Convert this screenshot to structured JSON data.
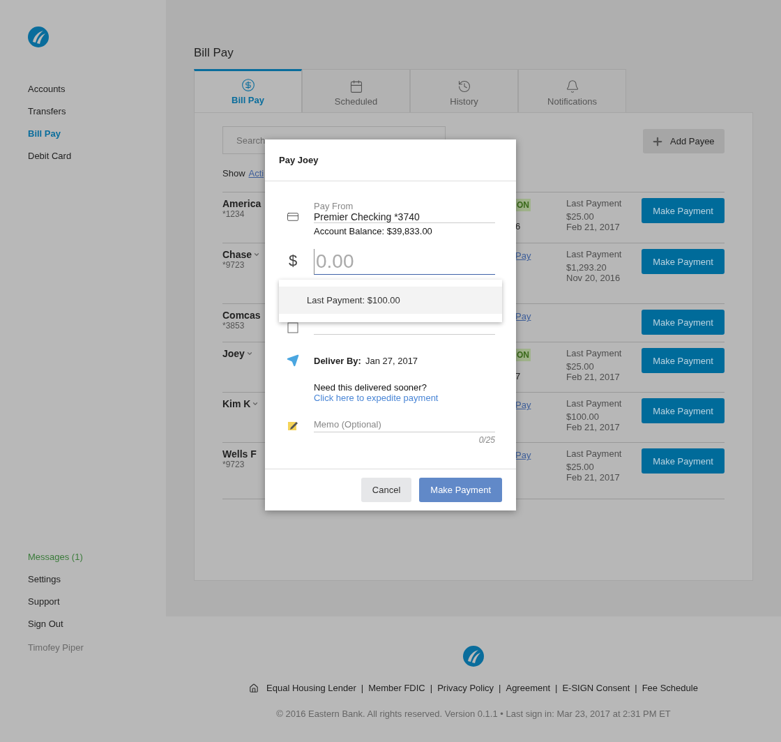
{
  "sidebar": {
    "nav": [
      {
        "label": "Accounts",
        "selected": false
      },
      {
        "label": "Transfers",
        "selected": false
      },
      {
        "label": "Bill Pay",
        "selected": true
      },
      {
        "label": "Debit Card",
        "selected": false
      }
    ],
    "bottom": [
      {
        "label": "Messages (1)",
        "alert": true
      },
      {
        "label": "Settings",
        "alert": false
      },
      {
        "label": "Support",
        "alert": false
      },
      {
        "label": "Sign Out",
        "alert": false
      }
    ],
    "user": "Timofey Piper"
  },
  "page_title": "Bill Pay",
  "tabs": [
    {
      "label": "Bill Pay",
      "selected": true
    },
    {
      "label": "Scheduled",
      "selected": false
    },
    {
      "label": "History",
      "selected": false
    },
    {
      "label": "Notifications",
      "selected": false
    }
  ],
  "search": {
    "placeholder": "Search"
  },
  "add_payee": "Add Payee",
  "show": {
    "label": "Show",
    "link": "Acti"
  },
  "payees": [
    {
      "name": "America",
      "account": "*1234",
      "menu": false,
      "status": {
        "kind": "badge",
        "text": "ON",
        "sub": "6"
      },
      "last_payment": {
        "label": "Last Payment",
        "amount": "$25.00",
        "date": "Feb 21, 2017"
      },
      "action": "Make Payment"
    },
    {
      "name": "Chase",
      "account": "*9723",
      "menu": true,
      "status": {
        "kind": "link",
        "text": "Pay"
      },
      "last_payment": {
        "label": "Last Payment",
        "amount": "$1,293.20",
        "date": "Nov 20, 2016"
      },
      "action": "Make Payment"
    },
    {
      "name": "Comcas",
      "account": "*3853",
      "menu": false,
      "status": {
        "kind": "link",
        "text": "Pay"
      },
      "action": "Make Payment"
    },
    {
      "name": "Joey",
      "menu": true,
      "status": {
        "kind": "badge",
        "text": "ON",
        "sub": "7"
      },
      "last_payment": {
        "label": "Last Payment",
        "amount": "$25.00",
        "date": "Feb 21, 2017"
      },
      "action": "Make Payment"
    },
    {
      "name": "Kim K",
      "menu": true,
      "status": {
        "kind": "link",
        "text": "Pay"
      },
      "last_payment": {
        "label": "Last Payment",
        "amount": "$100.00",
        "date": "Feb 21, 2017"
      },
      "action": "Make Payment"
    },
    {
      "name": "Wells F",
      "account": "*9723",
      "menu": false,
      "status": {
        "kind": "link",
        "text": "Pay"
      },
      "last_payment": {
        "label": "Last Payment",
        "amount": "$25.00",
        "date": "Feb 21, 2017"
      },
      "action": "Make Payment"
    }
  ],
  "dialog": {
    "title": "Pay Joey",
    "pay_from": {
      "label": "Pay From",
      "value": "Premier Checking *3740",
      "balance": "Account Balance: $39,833.00"
    },
    "amount": {
      "currency": "$",
      "placeholder": "0.00"
    },
    "suggestion": "Last Payment: $100.00",
    "deliver": {
      "label": "Deliver By:",
      "value": "Jan 27, 2017"
    },
    "sooner": "Need this delivered sooner?",
    "expedite_link": "Click here to expedite payment",
    "memo": {
      "placeholder": "Memo (Optional)",
      "counter": "0/25"
    },
    "buttons": [
      {
        "label": "Cancel",
        "kind": "secondary"
      },
      {
        "label": "Make Payment",
        "kind": "primary"
      }
    ]
  },
  "footer": {
    "separator": "|",
    "links": [
      "Equal Housing Lender",
      "Member FDIC",
      "Privacy Policy",
      "Agreement",
      "E-SIGN Consent",
      "Fee Schedule"
    ],
    "copyright": "© 2016 Eastern Bank. All rights reserved. Version 0.1.1 • Last sign in: Mar 23, 2017 at 2:31 PM ET"
  }
}
